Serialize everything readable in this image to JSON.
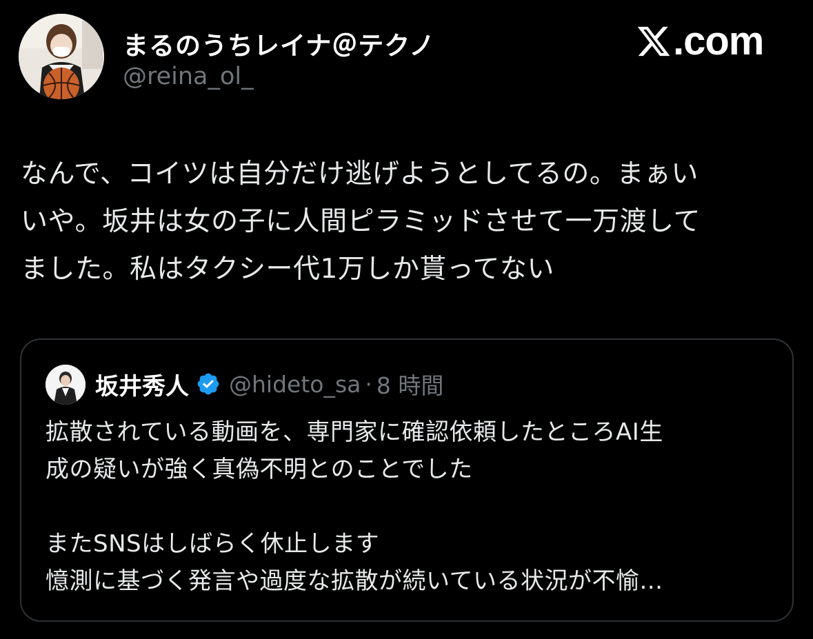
{
  "author": {
    "display_name": "まるのうちレイナ＠テクノ",
    "handle": "@reina_ol_"
  },
  "brand": {
    "text": ".com",
    "icon": "x-logo-icon"
  },
  "tweet": {
    "lines": [
      "なんで、コイツは自分だけ逃げようとしてるの。まぁい",
      "いや。坂井は女の子に人間ピラミッドさせて一万渡して",
      "ました。私はタクシー代1万しか貰ってない"
    ]
  },
  "quoted": {
    "display_name": "坂井秀人",
    "verified_icon": "verified-badge-icon",
    "handle": "@hideto_sa",
    "separator": "·",
    "time": "8 時間",
    "lines": [
      "拡散されている動画を、専門家に確認依頼したところAI生",
      "成の疑いが強く真偽不明とのことでした",
      "",
      "またSNSはしばらく休止します",
      "憶測に基づく発言や過度な拡散が続いている状況が不愉..."
    ]
  },
  "colors": {
    "background": "#000000",
    "text_primary": "#e7e9ea",
    "text_secondary": "#71767b",
    "border": "#2f3336",
    "verified": "#1d9bf0"
  }
}
